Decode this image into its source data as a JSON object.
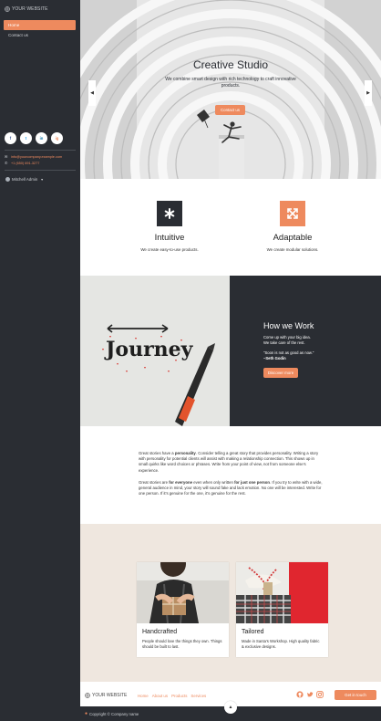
{
  "sidebar": {
    "brand": "YOUR WEBSITE",
    "nav": [
      {
        "label": "Home",
        "active": true
      },
      {
        "label": "Contact us",
        "active": false
      }
    ],
    "socials": [
      "f",
      "t",
      "in",
      "ig"
    ],
    "email": "info@yourcompany.example.com",
    "phone": "+1 (650) 691-3277",
    "user": "Mitchell Admin"
  },
  "hero": {
    "title": "Creative Studio",
    "subtitle": "We combine smart design with rich technology to craft innovative products.",
    "button": "Contact us"
  },
  "features": [
    {
      "title": "Intuitive",
      "text": "We create easy-to-use products.",
      "icon": "asterisk-icon"
    },
    {
      "title": "Adaptable",
      "text": "We create modular solutions.",
      "icon": "expand-arrows-icon"
    }
  ],
  "work": {
    "title": "How we Work",
    "line1": "Come up with your big idea.",
    "line2": "We take care of the rest.",
    "quote": "\"Soon is not as good as now.\"",
    "author": "–Seth Godin",
    "button": "Discover more",
    "image_word": "Journey"
  },
  "story": {
    "p1_a": "Great stories have a ",
    "p1_b": "personality",
    "p1_c": ". Consider telling a great story that provides personality. Writing a story with personality for potential clients will assist with making a relationship connection. This shows up in small quirks like word choices or phrases. Write from your point of view, not from someone else's experience.",
    "p2_a": "Great stories are ",
    "p2_b": "for everyone",
    "p2_c": " even when only written ",
    "p2_d": "for just one person",
    "p2_e": ". If you try to write with a wide, general audience in mind, your story will sound fake and lack emotion. No one will be interested. Write for one person. If it's genuine for the one, it's genuine for the rest."
  },
  "cards": [
    {
      "title": "Handcrafted",
      "text": "People should love the things they own. Things should be built to last."
    },
    {
      "title": "Tailored",
      "text": "Made in Santa's Workshop. High quality fabric & exclusive designs."
    }
  ],
  "footer": {
    "brand": "YOUR WEBSITE",
    "links": [
      "Home",
      "About us",
      "Products",
      "Services"
    ],
    "button": "Get in touch",
    "copyright": "Copyright © Company name"
  },
  "colors": {
    "accent": "#ee8a5e",
    "dark": "#2a2d33",
    "beige": "#efe7df"
  }
}
